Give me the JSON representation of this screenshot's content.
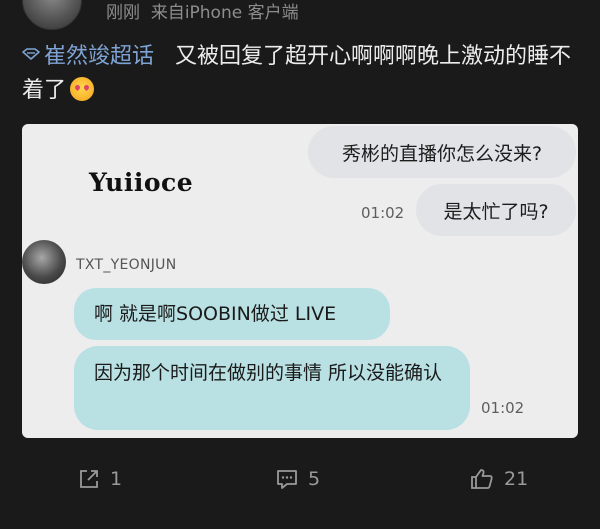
{
  "header": {
    "time": "刚刚",
    "source_prefix": "来自",
    "source": "iPhone 客户端"
  },
  "post": {
    "topic": "崔然竣超话",
    "text": "又被回复了超开心啊啊啊晚上激动的睡不着了",
    "emoji": "smiling-face-with-heart-eyes"
  },
  "chat": {
    "watermark": "Yuiioce",
    "messages_right": [
      {
        "text": "秀彬的直播你怎么没来?"
      },
      {
        "text": "是太忙了吗?"
      }
    ],
    "time_right": "01:02",
    "sender": "TXT_YEONJUN",
    "messages_left": [
      {
        "text": "啊 就是啊SOOBIN做过 LIVE"
      },
      {
        "text": "因为那个时间在做别的事情 所以没能确认"
      }
    ],
    "time_left": "01:02"
  },
  "actions": {
    "share_count": "1",
    "comment_count": "5",
    "like_count": "21"
  },
  "colors": {
    "background": "#1a1a1a",
    "topic": "#7fa3d4",
    "bubble_reply": "#b9e0e3",
    "bubble_sent": "#e2e3e6"
  }
}
